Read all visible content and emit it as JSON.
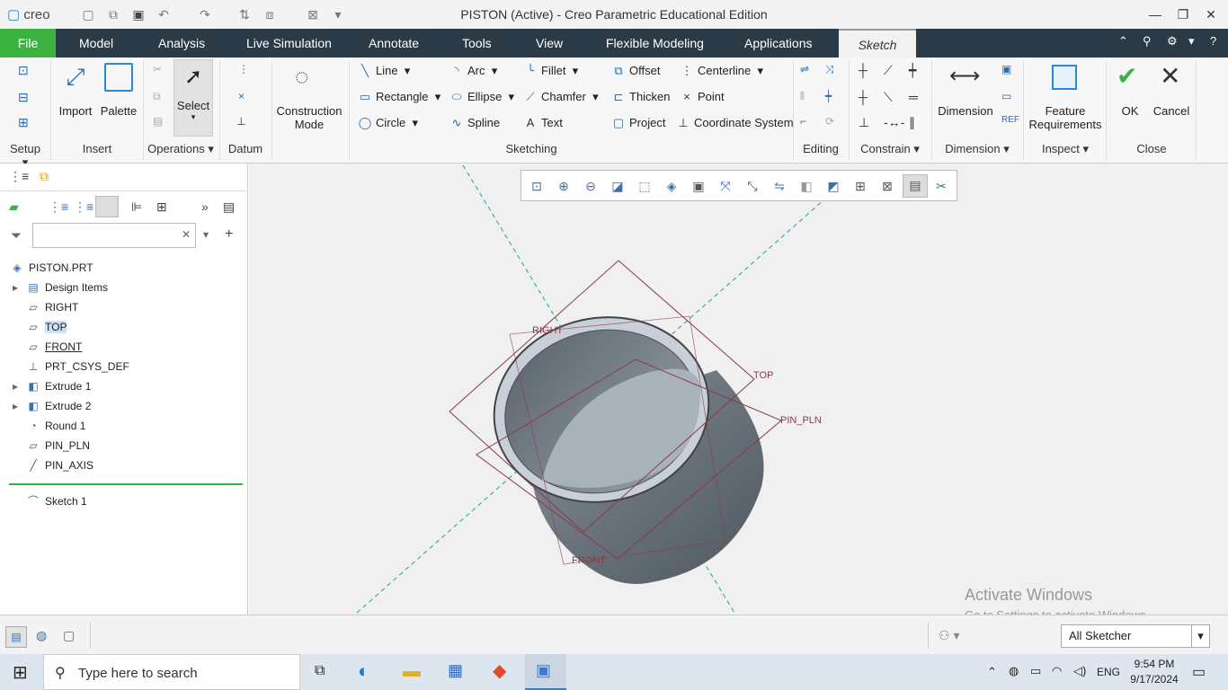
{
  "window": {
    "title": "PISTON (Active) - Creo Parametric Educational Edition",
    "logo": "creo"
  },
  "tabs": [
    {
      "label": "File"
    },
    {
      "label": "Model"
    },
    {
      "label": "Analysis"
    },
    {
      "label": "Live Simulation"
    },
    {
      "label": "Annotate"
    },
    {
      "label": "Tools"
    },
    {
      "label": "View"
    },
    {
      "label": "Flexible Modeling"
    },
    {
      "label": "Applications"
    },
    {
      "label": "Sketch"
    }
  ],
  "ribbon": {
    "groups": {
      "setup": "Setup",
      "insert": "Insert",
      "operations": "Operations",
      "datum": "Datum",
      "sketching": "Sketching",
      "editing": "Editing",
      "constrain": "Constrain",
      "dimension": "Dimension",
      "inspect": "Inspect",
      "close": "Close"
    },
    "big": {
      "import": "Import",
      "palette": "Palette",
      "select": "Select",
      "construction": "Construction Mode",
      "dimension": "Dimension",
      "feature_req": "Feature Requirements",
      "ok": "OK",
      "cancel": "Cancel"
    },
    "sketch": {
      "line": "Line",
      "arc": "Arc",
      "fillet": "Fillet",
      "offset": "Offset",
      "centerline": "Centerline",
      "rectangle": "Rectangle",
      "ellipse": "Ellipse",
      "chamfer": "Chamfer",
      "thicken": "Thicken",
      "point": "Point",
      "circle": "Circle",
      "spline": "Spline",
      "text": "Text",
      "project": "Project",
      "csys": "Coordinate System"
    }
  },
  "tree": {
    "root": "PISTON.PRT",
    "items": [
      {
        "label": "Design Items"
      },
      {
        "label": "RIGHT"
      },
      {
        "label": "TOP"
      },
      {
        "label": "FRONT"
      },
      {
        "label": "PRT_CSYS_DEF"
      },
      {
        "label": "Extrude 1"
      },
      {
        "label": "Extrude 2"
      },
      {
        "label": "Round 1"
      },
      {
        "label": "PIN_PLN"
      },
      {
        "label": "PIN_AXIS"
      }
    ],
    "sketch": "Sketch 1",
    "search_placeholder": ""
  },
  "viewport": {
    "labels": {
      "right": "RIGHT",
      "top": "TOP",
      "pin_pln": "PIN_PLN",
      "front": "FRONT"
    }
  },
  "status": {
    "filter": "All Sketcher"
  },
  "watermark": {
    "title": "Activate Windows",
    "sub": "Go to Settings to activate Windows."
  },
  "taskbar": {
    "search": "Type here to search",
    "time": "9:54 PM",
    "date": "9/17/2024",
    "lang": "ENG"
  },
  "colors": {
    "file_tab": "#3cb240",
    "tabbar": "#2b3a47",
    "accent": "#2a6ab0"
  }
}
